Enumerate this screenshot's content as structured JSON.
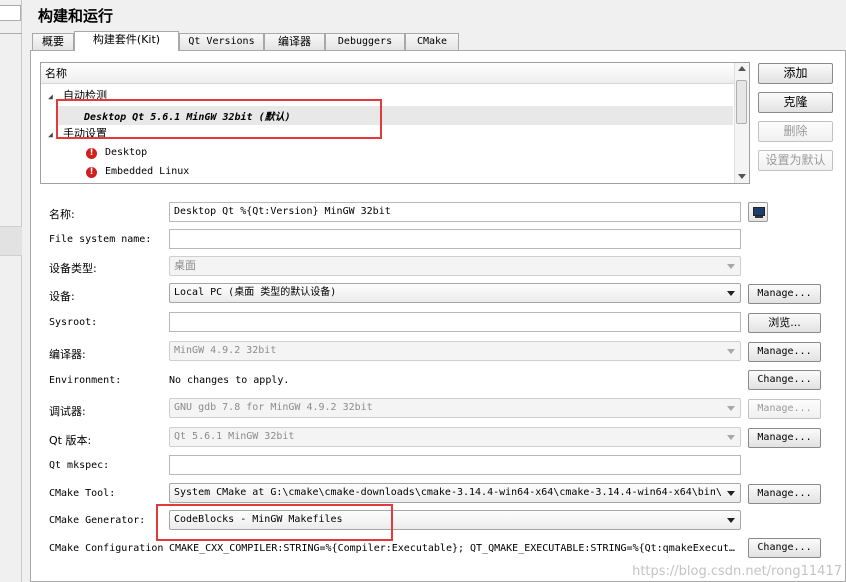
{
  "page": {
    "title": "构建和运行"
  },
  "tabs": [
    "概要",
    "构建套件(Kit)",
    "Qt Versions",
    "编译器",
    "Debuggers",
    "CMake"
  ],
  "tree": {
    "header": "名称",
    "auto_group": "自动检测",
    "auto_kit": "Desktop Qt 5.6.1 MinGW 32bit (默认)",
    "manual_group": "手动设置",
    "manual_items": [
      "Desktop",
      "Embedded Linux"
    ]
  },
  "side_buttons": {
    "add": "添加",
    "clone": "克隆",
    "delete": "删除",
    "set_default": "设置为默认"
  },
  "form": {
    "name": {
      "label": "名称:",
      "value": "Desktop Qt %{Qt:Version} MinGW 32bit"
    },
    "filesystem": {
      "label": "File system name:",
      "value": ""
    },
    "device_type": {
      "label": "设备类型:",
      "value": "桌面"
    },
    "device": {
      "label": "设备:",
      "value": "Local PC (桌面 类型的默认设备)",
      "button": "Manage..."
    },
    "sysroot": {
      "label": "Sysroot:",
      "value": "",
      "button": "浏览..."
    },
    "compiler": {
      "label": "编译器:",
      "value": "MinGW 4.9.2 32bit",
      "button": "Manage..."
    },
    "environment": {
      "label": "Environment:",
      "value": "No changes to apply.",
      "button": "Change..."
    },
    "debugger": {
      "label": "调试器:",
      "value": "GNU gdb 7.8 for MinGW 4.9.2 32bit",
      "button": "Manage..."
    },
    "qt_version": {
      "label": "Qt 版本:",
      "value": "Qt 5.6.1 MinGW 32bit",
      "button": "Manage..."
    },
    "mkspec": {
      "label": "Qt mkspec:",
      "value": ""
    },
    "cmake_tool": {
      "label": "CMake Tool:",
      "value": "System CMake at G:\\cmake\\cmake-downloads\\cmake-3.14.4-win64-x64\\cmake-3.14.4-win64-x64\\bin\\",
      "button": "Manage..."
    },
    "cmake_generator": {
      "label": "CMake Generator:",
      "value": "CodeBlocks - MinGW Makefiles"
    },
    "cmake_config": {
      "label": "CMake Configuration",
      "value": "CMAKE_CXX_COMPILER:STRING=%{Compiler:Executable}; QT_QMAKE_EXECUTABLE:STRING=%{Qt:qmakeExecut…",
      "button": "Change..."
    }
  },
  "watermark": "https://blog.csdn.net/rong11417",
  "colors": {
    "highlight": "#e23a3a",
    "error_icon": "#d0201d"
  }
}
